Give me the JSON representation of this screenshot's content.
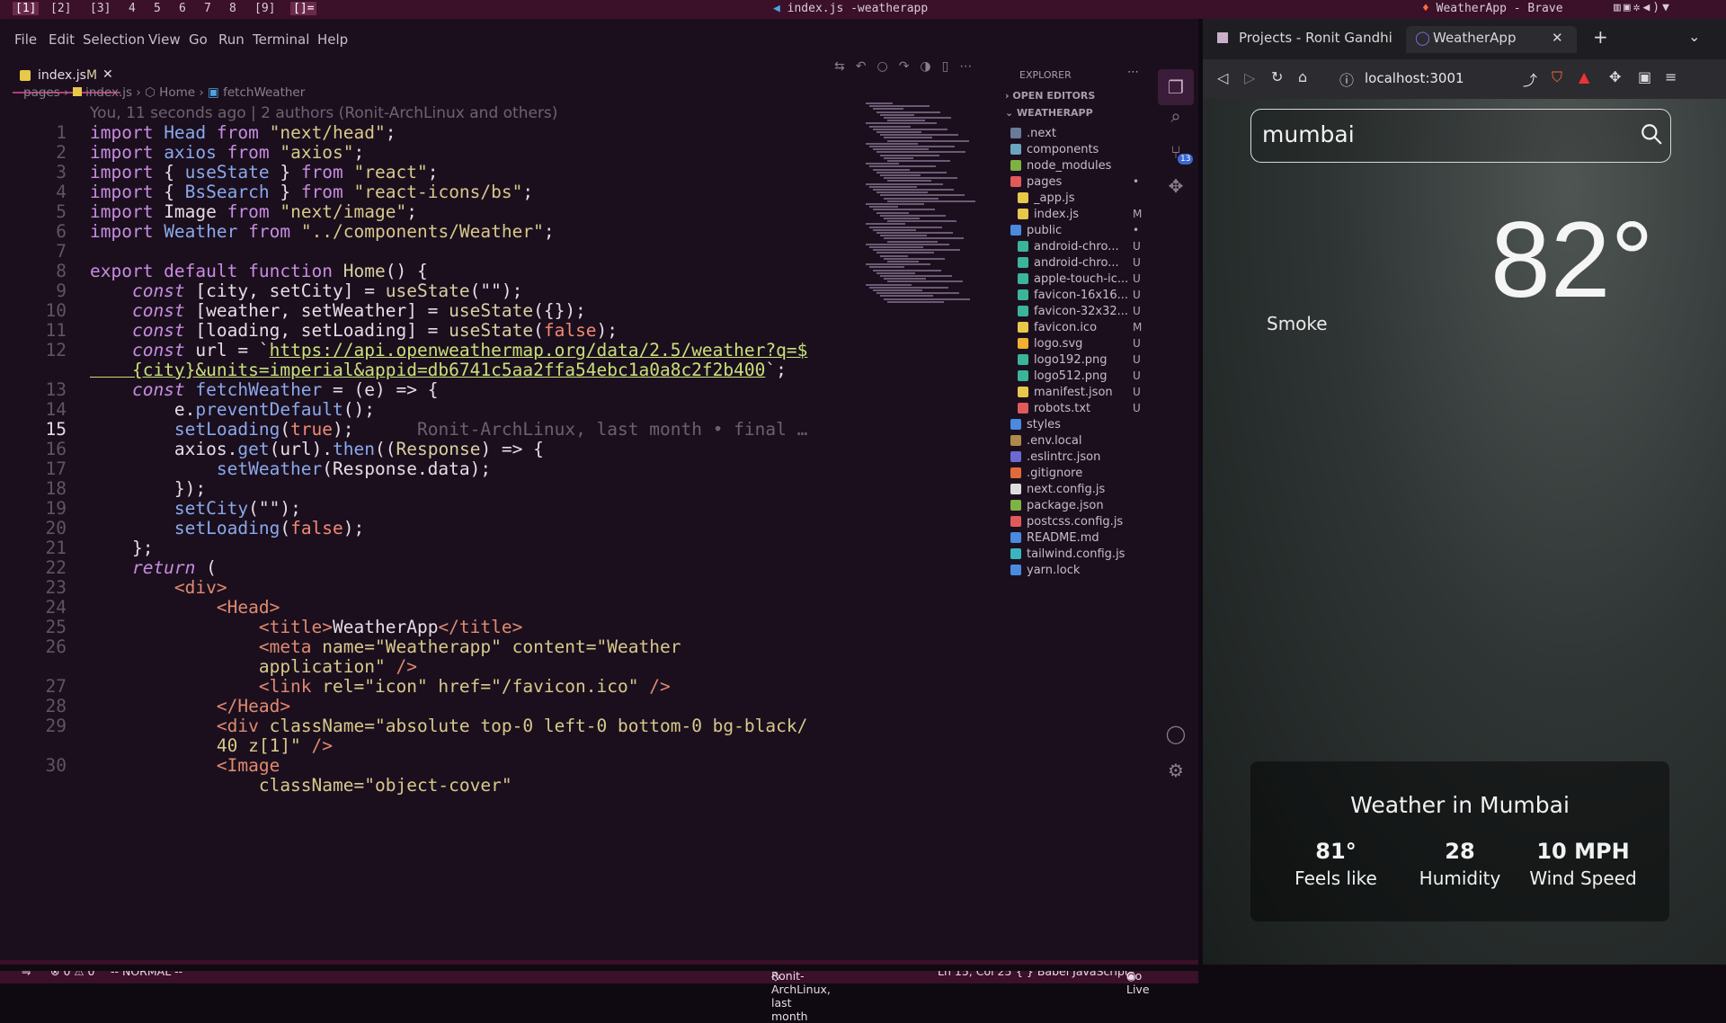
{
  "wm": {
    "workspaces": [
      "[1]",
      "[2]",
      "[3]",
      "4",
      "5",
      "6",
      "7",
      "8",
      "[9]",
      "[]="
    ],
    "window_title": "index.js -weatherapp",
    "right_title": "WeatherApp - Brave"
  },
  "vscode": {
    "menu": [
      "File",
      "Edit",
      "Selection",
      "View",
      "Go",
      "Run",
      "Terminal",
      "Help"
    ],
    "tab_label": "index.js",
    "tab_status": "M",
    "breadcrumb": [
      "pages",
      "index.js",
      "Home",
      "fetchWeather"
    ],
    "blame": "You, 11 seconds ago | 2 authors (Ronit-ArchLinux and others)",
    "inline_blame": "Ronit-ArchLinux, last month • final …",
    "code": [
      {
        "n": "1",
        "parts": [
          [
            "kw",
            "import "
          ],
          [
            "var",
            "Head"
          ],
          [
            "kw",
            " from "
          ],
          [
            "str",
            "\"next/head\""
          ],
          [
            "id",
            ";"
          ]
        ]
      },
      {
        "n": "2",
        "parts": [
          [
            "kw",
            "import "
          ],
          [
            "var",
            "axios"
          ],
          [
            "kw",
            " from "
          ],
          [
            "str",
            "\"axios\""
          ],
          [
            "id",
            ";"
          ]
        ]
      },
      {
        "n": "3",
        "parts": [
          [
            "kw",
            "import "
          ],
          [
            "id",
            "{ "
          ],
          [
            "var",
            "useState"
          ],
          [
            "id",
            " } "
          ],
          [
            "kw",
            "from "
          ],
          [
            "str",
            "\"react\""
          ],
          [
            "id",
            ";"
          ]
        ]
      },
      {
        "n": "4",
        "parts": [
          [
            "kw",
            "import "
          ],
          [
            "id",
            "{ "
          ],
          [
            "var",
            "BsSearch"
          ],
          [
            "id",
            " } "
          ],
          [
            "kw",
            "from "
          ],
          [
            "str",
            "\"react-icons/bs\""
          ],
          [
            "id",
            ";"
          ]
        ]
      },
      {
        "n": "5",
        "parts": [
          [
            "kw",
            "import "
          ],
          [
            "id",
            "Image"
          ],
          [
            "kw",
            " from "
          ],
          [
            "str",
            "\"next/image\""
          ],
          [
            "id",
            ";"
          ]
        ]
      },
      {
        "n": "6",
        "parts": [
          [
            "kw",
            "import "
          ],
          [
            "var",
            "Weather"
          ],
          [
            "kw",
            " from "
          ],
          [
            "str",
            "\"../components/Weather\""
          ],
          [
            "id",
            ";"
          ]
        ]
      },
      {
        "n": "7",
        "parts": []
      },
      {
        "n": "8",
        "parts": [
          [
            "kw",
            "export default function "
          ],
          [
            "fn",
            "Home"
          ],
          [
            "id",
            "() {"
          ]
        ]
      },
      {
        "n": "9",
        "parts": [
          [
            "it",
            "    const "
          ],
          [
            "id",
            "[city, setCity] = "
          ],
          [
            "fn",
            "useState"
          ],
          [
            "id",
            "(\"\");"
          ]
        ]
      },
      {
        "n": "10",
        "parts": [
          [
            "it",
            "    const "
          ],
          [
            "id",
            "[weather, setWeather] = "
          ],
          [
            "fn",
            "useState"
          ],
          [
            "id",
            "({});"
          ]
        ]
      },
      {
        "n": "11",
        "parts": [
          [
            "it",
            "    const "
          ],
          [
            "id",
            "[loading, setLoading] = "
          ],
          [
            "fn",
            "useState"
          ],
          [
            "id",
            "("
          ],
          [
            "bool",
            "false"
          ],
          [
            "id",
            ");"
          ]
        ]
      },
      {
        "n": "12",
        "parts": [
          [
            "it",
            "    const "
          ],
          [
            "id",
            "url = `"
          ],
          [
            "url",
            "https://api.openweathermap.org/data/2.5/weather?q=$"
          ]
        ]
      },
      {
        "n": "",
        "parts": [
          [
            "url",
            "    {city}&units=imperial&appid=db6741c5aa2ffa54ebc1a0a8c2f2b400"
          ],
          [
            "id",
            "`;"
          ]
        ]
      },
      {
        "n": "13",
        "parts": [
          [
            "it",
            "    const "
          ],
          [
            "var",
            "fetchWeather"
          ],
          [
            "id",
            " = (e) => {"
          ]
        ]
      },
      {
        "n": "14",
        "parts": [
          [
            "id",
            "        e."
          ],
          [
            "var",
            "preventDefault"
          ],
          [
            "id",
            "();"
          ]
        ]
      },
      {
        "n": "15",
        "parts": [
          [
            "var",
            "        setLoading"
          ],
          [
            "id",
            "("
          ],
          [
            "bool",
            "true"
          ],
          [
            "id",
            ");"
          ]
        ]
      },
      {
        "n": "16",
        "parts": [
          [
            "id",
            "        axios."
          ],
          [
            "var",
            "get"
          ],
          [
            "id",
            "(url)."
          ],
          [
            "var",
            "then"
          ],
          [
            "id",
            "(("
          ],
          [
            "fn",
            "Response"
          ],
          [
            "id",
            ") => {"
          ]
        ]
      },
      {
        "n": "17",
        "parts": [
          [
            "var",
            "            setWeather"
          ],
          [
            "id",
            "(Response.data);"
          ]
        ]
      },
      {
        "n": "18",
        "parts": [
          [
            "id",
            "        });"
          ]
        ]
      },
      {
        "n": "19",
        "parts": [
          [
            "var",
            "        setCity"
          ],
          [
            "id",
            "(\"\");"
          ]
        ]
      },
      {
        "n": "20",
        "parts": [
          [
            "var",
            "        setLoading"
          ],
          [
            "id",
            "("
          ],
          [
            "bool",
            "false"
          ],
          [
            "id",
            ");"
          ]
        ]
      },
      {
        "n": "21",
        "parts": [
          [
            "id",
            "    };"
          ]
        ]
      },
      {
        "n": "22",
        "parts": [
          [
            "it",
            "    return "
          ],
          [
            "id",
            "("
          ]
        ]
      },
      {
        "n": "23",
        "parts": [
          [
            "tag",
            "        <div>"
          ]
        ]
      },
      {
        "n": "24",
        "parts": [
          [
            "tag",
            "            <Head>"
          ]
        ]
      },
      {
        "n": "25",
        "parts": [
          [
            "tag",
            "                <title>"
          ],
          [
            "id",
            "WeatherApp"
          ],
          [
            "tag",
            "</title>"
          ]
        ]
      },
      {
        "n": "26",
        "parts": [
          [
            "tag",
            "                <meta "
          ],
          [
            "attr",
            "name=\"Weatherapp\" content=\"Weather"
          ]
        ]
      },
      {
        "n": "",
        "parts": [
          [
            "attr",
            "                application\""
          ],
          [
            "tag",
            " />"
          ]
        ]
      },
      {
        "n": "27",
        "parts": [
          [
            "tag",
            "                <link "
          ],
          [
            "attr",
            "rel=\"icon\" href=\"/favicon.ico\""
          ],
          [
            "tag",
            " />"
          ]
        ]
      },
      {
        "n": "28",
        "parts": [
          [
            "tag",
            "            </Head>"
          ]
        ]
      },
      {
        "n": "29",
        "parts": [
          [
            "tag",
            "            <div "
          ],
          [
            "attr",
            "className=\"absolute top-0 left-0 bottom-0 bg-black/"
          ]
        ]
      },
      {
        "n": "",
        "parts": [
          [
            "attr",
            "            40 z[1]\""
          ],
          [
            "tag",
            " />"
          ]
        ]
      },
      {
        "n": "30",
        "parts": [
          [
            "tag",
            "            <Image"
          ]
        ]
      },
      {
        "n": "",
        "parts": [
          [
            "attr",
            "                className=\"object-cover\""
          ]
        ]
      }
    ],
    "explorer_title": "EXPLORER",
    "open_editors": "OPEN EDITORS",
    "project": "WEATHERAPP",
    "files": [
      {
        "name": ".next",
        "indent": 0,
        "color": "#6a7a9a",
        "status": ""
      },
      {
        "name": "components",
        "indent": 0,
        "color": "#6aa6c0",
        "status": ""
      },
      {
        "name": "node_modules",
        "indent": 0,
        "color": "#7cb342",
        "status": ""
      },
      {
        "name": "pages",
        "indent": 0,
        "color": "#e05a5a",
        "status": "•"
      },
      {
        "name": "_app.js",
        "indent": 1,
        "color": "#e8c84a",
        "status": ""
      },
      {
        "name": "index.js",
        "indent": 1,
        "color": "#e8c84a",
        "status": "M"
      },
      {
        "name": "public",
        "indent": 0,
        "color": "#4a8ae0",
        "status": "•"
      },
      {
        "name": "android-chro...",
        "indent": 1,
        "color": "#3ab59a",
        "status": "U"
      },
      {
        "name": "android-chro...",
        "indent": 1,
        "color": "#3ab59a",
        "status": "U"
      },
      {
        "name": "apple-touch-ic...",
        "indent": 1,
        "color": "#3ab59a",
        "status": "U"
      },
      {
        "name": "favicon-16x16...",
        "indent": 1,
        "color": "#3ab59a",
        "status": "U"
      },
      {
        "name": "favicon-32x32...",
        "indent": 1,
        "color": "#3ab59a",
        "status": "U"
      },
      {
        "name": "favicon.ico",
        "indent": 1,
        "color": "#e8c84a",
        "status": "M"
      },
      {
        "name": "logo.svg",
        "indent": 1,
        "color": "#f0b030",
        "status": "U"
      },
      {
        "name": "logo192.png",
        "indent": 1,
        "color": "#3ab59a",
        "status": "U"
      },
      {
        "name": "logo512.png",
        "indent": 1,
        "color": "#3ab59a",
        "status": "U"
      },
      {
        "name": "manifest.json",
        "indent": 1,
        "color": "#e8c84a",
        "status": "U"
      },
      {
        "name": "robots.txt",
        "indent": 1,
        "color": "#e05a5a",
        "status": "U"
      },
      {
        "name": "styles",
        "indent": 0,
        "color": "#4a8ae0",
        "status": ""
      },
      {
        "name": ".env.local",
        "indent": 0,
        "color": "#b08a4a",
        "status": ""
      },
      {
        "name": ".eslintrc.json",
        "indent": 0,
        "color": "#6a6ad0",
        "status": ""
      },
      {
        "name": ".gitignore",
        "indent": 0,
        "color": "#e06a3a",
        "status": ""
      },
      {
        "name": "next.config.js",
        "indent": 0,
        "color": "#dddddd",
        "status": ""
      },
      {
        "name": "package.json",
        "indent": 0,
        "color": "#7cb342",
        "status": ""
      },
      {
        "name": "postcss.config.js",
        "indent": 0,
        "color": "#e05a5a",
        "status": ""
      },
      {
        "name": "README.md",
        "indent": 0,
        "color": "#4a8ae0",
        "status": ""
      },
      {
        "name": "tailwind.config.js",
        "indent": 0,
        "color": "#3ab5c0",
        "status": ""
      },
      {
        "name": "yarn.lock",
        "indent": 0,
        "color": "#4a8ae0",
        "status": ""
      }
    ],
    "scm_badge": "13",
    "status": {
      "errors": "⊗ 0 ⚠ 0",
      "mode": "-- NORMAL --",
      "blame": "Ronit-ArchLinux, last month",
      "position": "Ln 15, Col 25",
      "language": "{ } Babel JavaScript",
      "golive": "Go Live"
    }
  },
  "browser": {
    "tab1": "Projects - Ronit Gandhi",
    "tab2": "WeatherApp",
    "url": "localhost:3001",
    "search_value": "mumbai",
    "temperature": "82°",
    "description": "Smoke",
    "card_title": "Weather in Mumbai",
    "stats": [
      {
        "value": "81°",
        "label": "Feels like"
      },
      {
        "value": "28",
        "label": "Humidity"
      },
      {
        "value": "10 MPH",
        "label": "Wind Speed"
      }
    ]
  }
}
